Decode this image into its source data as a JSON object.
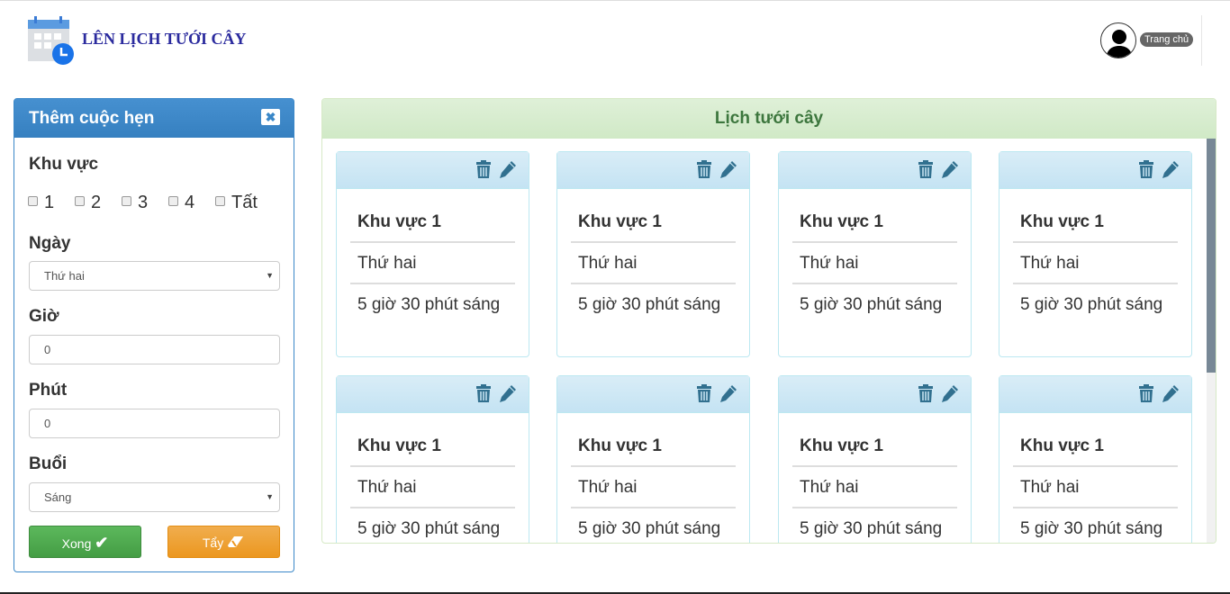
{
  "header": {
    "title": "LÊN LỊCH TƯỚI CÂY",
    "home_label": "Trang chủ"
  },
  "form": {
    "title": "Thêm cuộc hẹn",
    "area_label": "Khu vực",
    "area_options": [
      "1",
      "2",
      "3",
      "4",
      "Tất"
    ],
    "day_label": "Ngày",
    "day_value": "Thứ hai",
    "hour_label": "Giờ",
    "hour_value": "0",
    "minute_label": "Phút",
    "minute_value": "0",
    "session_label": "Buổi",
    "session_value": "Sáng",
    "done_label": "Xong",
    "clear_label": "Tẩy"
  },
  "schedule": {
    "title": "Lịch tưới cây",
    "cards": [
      {
        "area": "Khu vực 1",
        "day": "Thứ hai",
        "time": "5 giờ 30 phút sáng"
      },
      {
        "area": "Khu vực 1",
        "day": "Thứ hai",
        "time": "5 giờ 30 phút sáng"
      },
      {
        "area": "Khu vực 1",
        "day": "Thứ hai",
        "time": "5 giờ 30 phút sáng"
      },
      {
        "area": "Khu vực 1",
        "day": "Thứ hai",
        "time": "5 giờ 30 phút sáng"
      },
      {
        "area": "Khu vực 1",
        "day": "Thứ hai",
        "time": "5 giờ 30 phút sáng"
      },
      {
        "area": "Khu vực 1",
        "day": "Thứ hai",
        "time": "5 giờ 30 phút sáng"
      },
      {
        "area": "Khu vực 1",
        "day": "Thứ hai",
        "time": "5 giờ 30 phút sáng"
      },
      {
        "area": "Khu vực 1",
        "day": "Thứ hai",
        "time": "5 giờ 30 phút sáng"
      }
    ]
  },
  "colors": {
    "primary": "#3a87c8",
    "success": "#5cb85c",
    "warning": "#f0ad4e",
    "icon": "#31708f"
  }
}
